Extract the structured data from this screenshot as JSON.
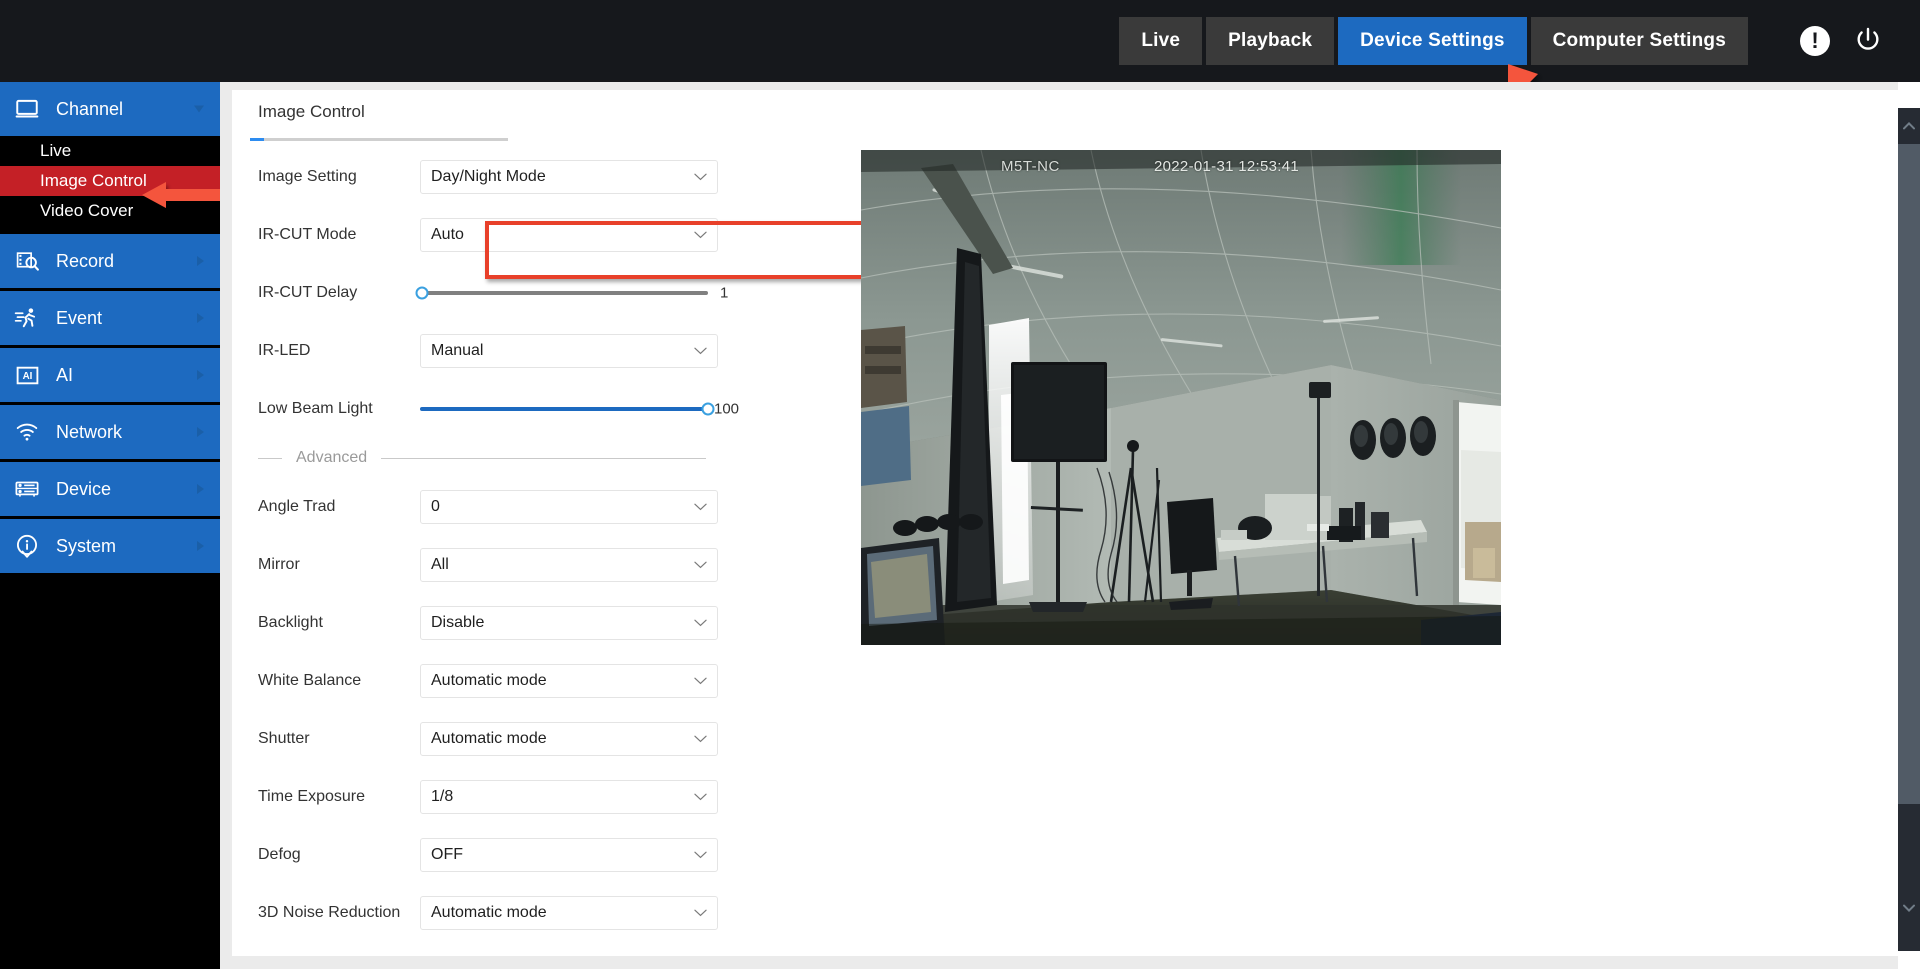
{
  "topbar": {
    "tabs": [
      {
        "label": "Live",
        "active": false
      },
      {
        "label": "Playback",
        "active": false
      },
      {
        "label": "Device Settings",
        "active": true
      },
      {
        "label": "Computer Settings",
        "active": false
      }
    ],
    "alert_icon": "alert-exclamation-icon",
    "power_icon": "power-icon",
    "active_color": "#1d6ac0",
    "background": "#16181c"
  },
  "sidebar": {
    "groups": [
      {
        "label": "Channel",
        "icon": "monitor-icon",
        "expanded": true,
        "items": [
          {
            "label": "Live",
            "active": false
          },
          {
            "label": "Image Control",
            "active": true
          },
          {
            "label": "Video Cover",
            "active": false
          }
        ]
      },
      {
        "label": "Record",
        "icon": "record-search-icon",
        "expanded": false,
        "items": []
      },
      {
        "label": "Event",
        "icon": "running-person-icon",
        "expanded": false,
        "items": []
      },
      {
        "label": "AI",
        "icon": "ai-box-icon",
        "expanded": false,
        "items": []
      },
      {
        "label": "Network",
        "icon": "wifi-icon",
        "expanded": false,
        "items": []
      },
      {
        "label": "Device",
        "icon": "server-icon",
        "expanded": false,
        "items": []
      },
      {
        "label": "System",
        "icon": "info-circle-icon",
        "expanded": false,
        "items": []
      }
    ],
    "active_item_color": "#c42026",
    "group_color": "#1d6ac0"
  },
  "panel": {
    "title": "Image Control",
    "advanced_label": "Advanced",
    "fields": [
      {
        "label": "Image Setting",
        "type": "select",
        "value": "Day/Night Mode",
        "highlighted": true
      },
      {
        "label": "IR-CUT Mode",
        "type": "select",
        "value": "Auto",
        "highlighted": false
      },
      {
        "label": "IR-CUT Delay",
        "type": "slider",
        "value": "1",
        "percent": 0,
        "filled": false
      },
      {
        "label": "IR-LED",
        "type": "select",
        "value": "Manual",
        "highlighted": false
      },
      {
        "label": "Low Beam Light",
        "type": "slider",
        "value": "100",
        "percent": 100,
        "filled": true
      },
      {
        "label": "Angle Trad",
        "type": "select",
        "value": "0",
        "highlighted": false
      },
      {
        "label": "Mirror",
        "type": "select",
        "value": "All",
        "highlighted": false
      },
      {
        "label": "Backlight",
        "type": "select",
        "value": "Disable",
        "highlighted": false
      },
      {
        "label": "White Balance",
        "type": "select",
        "value": "Automatic mode",
        "highlighted": false
      },
      {
        "label": "Shutter",
        "type": "select",
        "value": "Automatic mode",
        "highlighted": false
      },
      {
        "label": "Time Exposure",
        "type": "select",
        "value": "1/8",
        "highlighted": false
      },
      {
        "label": "Defog",
        "type": "select",
        "value": "OFF",
        "highlighted": false
      },
      {
        "label": "3D Noise Reduction",
        "type": "select",
        "value": "Automatic mode",
        "highlighted": false
      }
    ]
  },
  "video_preview": {
    "camera_name": "M5T-NC",
    "timestamp": "2022-01-31 12:53:41",
    "description": "office-room-camera-feed"
  },
  "annotations": {
    "highlight_color": "#e8402a",
    "arrow_to_device_settings": "red-arrow-icon",
    "arrow_to_image_control": "red-arrow-icon"
  },
  "scrollbar": {
    "orientation": "vertical",
    "up_icon": "chevron-up-icon",
    "down_icon": "chevron-down-icon"
  }
}
